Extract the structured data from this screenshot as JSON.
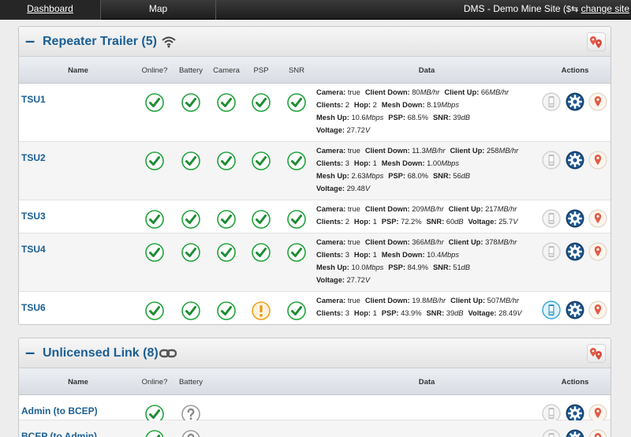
{
  "nav": {
    "tabs": [
      "Dashboard",
      "Map"
    ],
    "site_prefix": "DMS - Demo Mine Site (",
    "change_site": "change site"
  },
  "colors": {
    "title_blue": "#1b5f94",
    "ok_green": "#20a33a",
    "warn_orange": "#f0a21c",
    "unknown_gray": "#9a9a9a",
    "gear_navy": "#173e6a",
    "map_red": "#e35a46"
  },
  "repeater": {
    "title": "Repeater Trailer (5)",
    "header_icon": "wifi-icon",
    "columns": [
      "Name",
      "Online?",
      "Battery",
      "Camera",
      "PSP",
      "SNR",
      "Data",
      "Actions"
    ],
    "rows": [
      {
        "name": "TSU1",
        "status": [
          "ok",
          "ok",
          "ok",
          "ok",
          "ok"
        ],
        "phone": "inactive",
        "lines": [
          [
            [
              "Camera:",
              "true",
              ""
            ],
            [
              "Client Down:",
              "80",
              "MB/hr"
            ],
            [
              "Client Up:",
              "66",
              "MB/hr"
            ]
          ],
          [
            [
              "Clients:",
              "2",
              ""
            ],
            [
              "Hop:",
              "2",
              ""
            ],
            [
              "Mesh Down:",
              "8.19",
              "Mbps"
            ]
          ],
          [
            [
              "Mesh Up:",
              "10.6",
              "Mbps"
            ],
            [
              "PSP:",
              "68.5%",
              ""
            ],
            [
              "SNR:",
              "39",
              "dB"
            ]
          ],
          [
            [
              "Voltage:",
              "27.72",
              "V"
            ]
          ]
        ]
      },
      {
        "name": "TSU2",
        "status": [
          "ok",
          "ok",
          "ok",
          "ok",
          "ok"
        ],
        "phone": "inactive",
        "lines": [
          [
            [
              "Camera:",
              "true",
              ""
            ],
            [
              "Client Down:",
              "11.3",
              "MB/hr"
            ],
            [
              "Client Up:",
              "258",
              "MB/hr"
            ]
          ],
          [
            [
              "Clients:",
              "3",
              ""
            ],
            [
              "Hop:",
              "1",
              ""
            ],
            [
              "Mesh Down:",
              "1.00",
              "Mbps"
            ]
          ],
          [
            [
              "Mesh Up:",
              "2.63",
              "Mbps"
            ],
            [
              "PSP:",
              "68.0%",
              ""
            ],
            [
              "SNR:",
              "56",
              "dB"
            ]
          ],
          [
            [
              "Voltage:",
              "29.48",
              "V"
            ]
          ]
        ]
      },
      {
        "name": "TSU3",
        "status": [
          "ok",
          "ok",
          "ok",
          "ok",
          "ok"
        ],
        "phone": "inactive",
        "lines": [
          [
            [
              "Camera:",
              "true",
              ""
            ],
            [
              "Client Down:",
              "209",
              "MB/hr"
            ],
            [
              "Client Up:",
              "217",
              "MB/hr"
            ]
          ],
          [
            [
              "Clients:",
              "2",
              ""
            ],
            [
              "Hop:",
              "1",
              ""
            ],
            [
              "PSP:",
              "72.2%",
              ""
            ],
            [
              "SNR:",
              "60",
              "dB"
            ],
            [
              "Voltage:",
              "25.7",
              "V"
            ]
          ]
        ]
      },
      {
        "name": "TSU4",
        "status": [
          "ok",
          "ok",
          "ok",
          "ok",
          "ok"
        ],
        "phone": "inactive",
        "lines": [
          [
            [
              "Camera:",
              "true",
              ""
            ],
            [
              "Client Down:",
              "366",
              "MB/hr"
            ],
            [
              "Client Up:",
              "378",
              "MB/hr"
            ]
          ],
          [
            [
              "Clients:",
              "3",
              ""
            ],
            [
              "Hop:",
              "1",
              ""
            ],
            [
              "Mesh Down:",
              "10.4",
              "Mbps"
            ]
          ],
          [
            [
              "Mesh Up:",
              "10.0",
              "Mbps"
            ],
            [
              "PSP:",
              "84.9%",
              ""
            ],
            [
              "SNR:",
              "51",
              "dB"
            ]
          ],
          [
            [
              "Voltage:",
              "27.72",
              "V"
            ]
          ]
        ]
      },
      {
        "name": "TSU6",
        "status": [
          "ok",
          "ok",
          "ok",
          "warn",
          "ok"
        ],
        "phone": "active",
        "lines": [
          [
            [
              "Camera:",
              "true",
              ""
            ],
            [
              "Client Down:",
              "19.8",
              "MB/hr"
            ],
            [
              "Client Up:",
              "507",
              "MB/hr"
            ]
          ],
          [
            [
              "Clients:",
              "3",
              ""
            ],
            [
              "Hop:",
              "1",
              ""
            ],
            [
              "PSP:",
              "43.9%",
              ""
            ],
            [
              "SNR:",
              "39",
              "dB"
            ],
            [
              "Voltage:",
              "28.49",
              "V"
            ]
          ]
        ]
      }
    ]
  },
  "unlicensed": {
    "title": "Unlicensed Link (8)",
    "header_icon": "link-icon",
    "columns": [
      "Name",
      "Online?",
      "Battery",
      "Data",
      "Actions"
    ],
    "rows": [
      {
        "name": "Admin (to BCEP)",
        "status": [
          "ok",
          "unknown"
        ],
        "phone": "inactive"
      },
      {
        "name": "BCEP (to Admin)",
        "status": [
          "ok",
          "unknown"
        ],
        "phone": "inactive"
      }
    ]
  }
}
